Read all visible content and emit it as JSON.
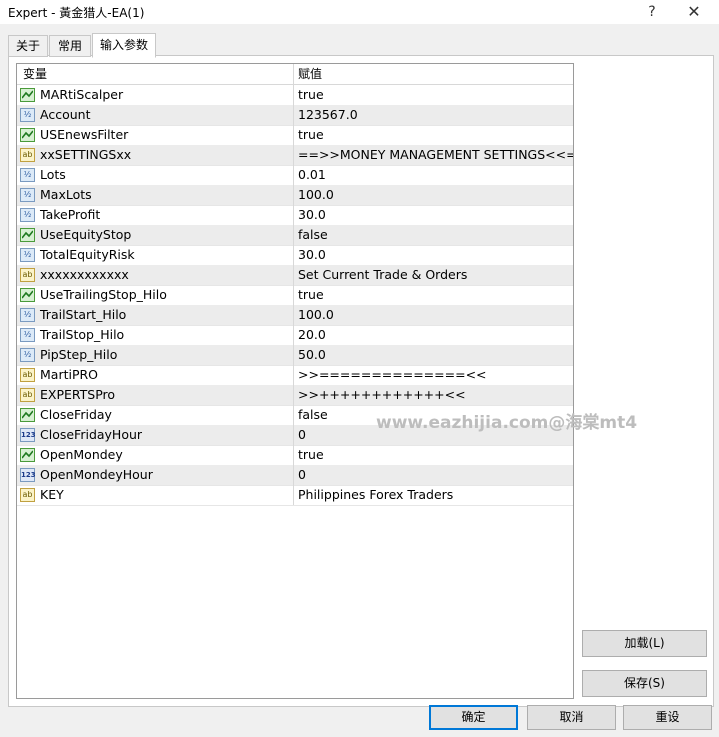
{
  "window": {
    "title": "Expert - 黃金猎人-EA(1)",
    "help": "?",
    "close": "✕"
  },
  "tabs": [
    {
      "label": "关于",
      "active": false
    },
    {
      "label": "常用",
      "active": false
    },
    {
      "label": "输入参数",
      "active": true
    }
  ],
  "grid": {
    "headers": {
      "variable": "变量",
      "value": "赋值"
    },
    "rows": [
      {
        "type": "bool",
        "icon": "bool-icon",
        "name": "MARtiScalper",
        "value": "true"
      },
      {
        "type": "dbl",
        "icon": "double-icon",
        "name": "Account",
        "value": "123567.0"
      },
      {
        "type": "bool",
        "icon": "bool-icon",
        "name": "USEnewsFilter",
        "value": "true"
      },
      {
        "type": "str",
        "icon": "string-icon",
        "name": "xxSETTINGSxx",
        "value": "==>>MONEY MANAGEMENT SETTINGS<<=="
      },
      {
        "type": "dbl",
        "icon": "double-icon",
        "name": "Lots",
        "value": "0.01"
      },
      {
        "type": "dbl",
        "icon": "double-icon",
        "name": "MaxLots",
        "value": "100.0"
      },
      {
        "type": "dbl",
        "icon": "double-icon",
        "name": "TakeProfit",
        "value": "30.0"
      },
      {
        "type": "bool",
        "icon": "bool-icon",
        "name": "UseEquityStop",
        "value": "false"
      },
      {
        "type": "dbl",
        "icon": "double-icon",
        "name": "TotalEquityRisk",
        "value": "30.0"
      },
      {
        "type": "str",
        "icon": "string-icon",
        "name": "xxxxxxxxxxxx",
        "value": "Set Current Trade & Orders"
      },
      {
        "type": "bool",
        "icon": "bool-icon",
        "name": "UseTrailingStop_Hilo",
        "value": "true"
      },
      {
        "type": "dbl",
        "icon": "double-icon",
        "name": "TrailStart_Hilo",
        "value": "100.0"
      },
      {
        "type": "dbl",
        "icon": "double-icon",
        "name": "TrailStop_Hilo",
        "value": "20.0"
      },
      {
        "type": "dbl",
        "icon": "double-icon",
        "name": "PipStep_Hilo",
        "value": "50.0"
      },
      {
        "type": "str",
        "icon": "string-icon",
        "name": "MartiPRO",
        "value": ">>==============<<"
      },
      {
        "type": "str",
        "icon": "string-icon",
        "name": "EXPERTSPro",
        "value": ">>++++++++++++<<"
      },
      {
        "type": "bool",
        "icon": "bool-icon",
        "name": "CloseFriday",
        "value": "false"
      },
      {
        "type": "int",
        "icon": "integer-icon",
        "name": "CloseFridayHour",
        "value": "0"
      },
      {
        "type": "bool",
        "icon": "bool-icon",
        "name": "OpenMondey",
        "value": "true"
      },
      {
        "type": "int",
        "icon": "integer-icon",
        "name": "OpenMondeyHour",
        "value": "0"
      },
      {
        "type": "str",
        "icon": "string-icon",
        "name": "KEY",
        "value": "Philippines Forex Traders"
      }
    ]
  },
  "icon_text": {
    "dbl": "½",
    "str": "ab",
    "int": "123"
  },
  "watermark": "www.eazhijia.com@海棠mt4",
  "buttons": {
    "load": "加载(L)",
    "save": "保存(S)",
    "ok": "确定",
    "cancel": "取消",
    "reset": "重设"
  }
}
